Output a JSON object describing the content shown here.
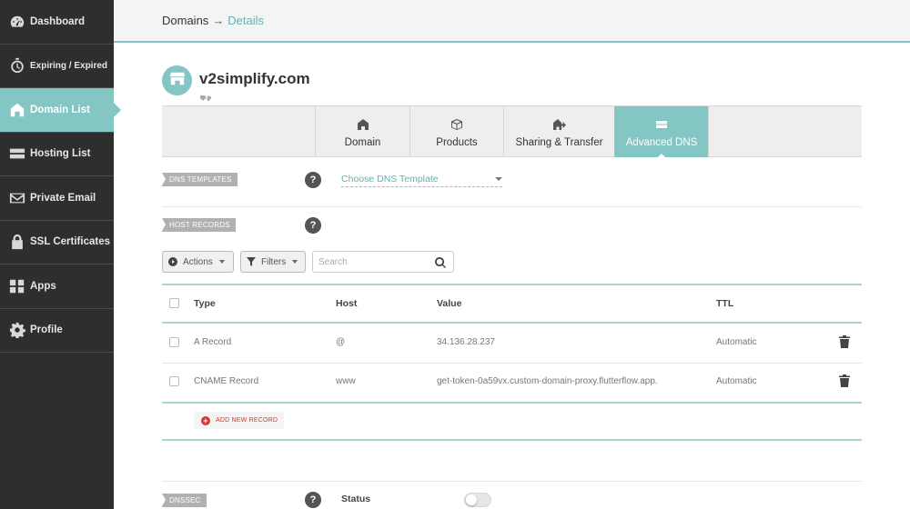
{
  "sidebar": {
    "items": [
      {
        "label": "Dashboard",
        "icon": "dashboard-gauge-icon"
      },
      {
        "label": "Expiring / Expired",
        "icon": "stopwatch-icon"
      },
      {
        "label": "Domain List",
        "icon": "home-icon",
        "active": true
      },
      {
        "label": "Hosting List",
        "icon": "server-icon"
      },
      {
        "label": "Private Email",
        "icon": "envelope-icon"
      },
      {
        "label": "SSL Certificates",
        "icon": "lock-icon"
      },
      {
        "label": "Apps",
        "icon": "apps-grid-icon"
      },
      {
        "label": "Profile",
        "icon": "gear-icon"
      }
    ]
  },
  "breadcrumb": {
    "root": "Domains",
    "separator": "→",
    "current": "Details"
  },
  "domain": {
    "name": "v2simplify.com",
    "avatar_icon": "storefront-icon",
    "tag_icon": "tag-heart-icon"
  },
  "tabs": [
    {
      "label": "Domain",
      "icon": "house-icon"
    },
    {
      "label": "Products",
      "icon": "box-icon"
    },
    {
      "label": "Sharing & Transfer",
      "icon": "house-share-icon"
    },
    {
      "label": "Advanced DNS",
      "icon": "dns-server-icon",
      "active": true
    }
  ],
  "dns_templates": {
    "label": "DNS TEMPLATES",
    "select_value": "Choose DNS Template",
    "help": "?"
  },
  "host_records": {
    "label": "HOST RECORDS",
    "help": "?",
    "toolbar": {
      "actions": "Actions",
      "filters": "Filters",
      "search_placeholder": "Search"
    },
    "columns": [
      "Type",
      "Host",
      "Value",
      "TTL"
    ],
    "rows": [
      {
        "type": "A Record",
        "host": "@",
        "value": "34.136.28.237",
        "ttl": "Automatic"
      },
      {
        "type": "CNAME Record",
        "host": "www",
        "value": "get-token-0a59vx.custom-domain-proxy.flutterflow.app.",
        "ttl": "Automatic"
      }
    ],
    "add_label": "ADD NEW RECORD",
    "add_icon": "+"
  },
  "dnssec": {
    "label": "DNSSEC",
    "help": "?",
    "status_label": "Status",
    "enabled": false
  },
  "colors": {
    "accent": "#84c6c4",
    "sidebar": "#2e2e2e",
    "danger": "#d23b2f"
  }
}
